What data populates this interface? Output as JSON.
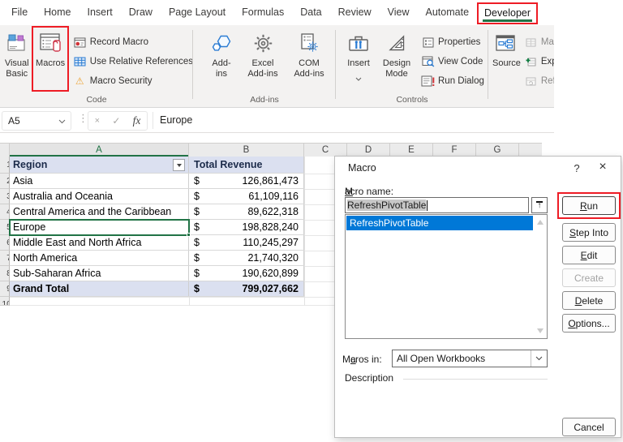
{
  "colors": {
    "excel_green": "#217346",
    "annotation_red": "#ee1c25",
    "selection_blue": "#0078d7",
    "table_header_fill": "#dbe0f0",
    "ribbon_bg": "#f3f2f1"
  },
  "icons": {
    "more_dots": "⋮",
    "cancel_x": "×",
    "check": "✓",
    "warning": "⚠",
    "up_arrow": "↑"
  },
  "ribbon": {
    "tabs": [
      "File",
      "Home",
      "Insert",
      "Draw",
      "Page Layout",
      "Formulas",
      "Data",
      "Review",
      "View",
      "Automate",
      "Developer"
    ],
    "active_tab": "Developer",
    "code_group": {
      "label": "Code",
      "visual_basic": {
        "line1": "Visual",
        "line2": "Basic"
      },
      "macros": "Macros",
      "record_macro": "Record Macro",
      "use_relative_references": "Use Relative References",
      "macro_security": "Macro Security"
    },
    "addins_group": {
      "label": "Add-ins",
      "addins": {
        "line1": "Add-",
        "line2": "ins"
      },
      "excel_addins": {
        "line1": "Excel",
        "line2": "Add-ins"
      },
      "com_addins": {
        "line1": "COM",
        "line2": "Add-ins"
      }
    },
    "controls_group": {
      "label": "Controls",
      "insert": "Insert",
      "design_mode": {
        "line1": "Design",
        "line2": "Mode"
      },
      "properties": "Properties",
      "view_code": "View Code",
      "run_dialog": "Run Dialog"
    },
    "xml_group": {
      "source": "Source",
      "map_properties": "Map Properties",
      "expansion_packs": "Expansion Packs",
      "refresh_data": "Refresh Data"
    }
  },
  "formula_bar": {
    "name_box": "A5",
    "fx": "fx",
    "formula": "Europe"
  },
  "sheet": {
    "columns": [
      "A",
      "B",
      "C",
      "D",
      "E",
      "F",
      "G"
    ],
    "selected_column": "A",
    "selected_cell": "A5",
    "row_numbers": [
      "1",
      "2",
      "3",
      "4",
      "5",
      "6",
      "7",
      "8",
      "9",
      "10"
    ],
    "table": {
      "header": {
        "region": "Region",
        "total_revenue": "Total Revenue"
      },
      "currency": "$",
      "rows": [
        {
          "region": "Asia",
          "amount": "126,861,473"
        },
        {
          "region": "Australia and Oceania",
          "amount": "61,109,116"
        },
        {
          "region": "Central America and the Caribbean",
          "amount": "89,622,318"
        },
        {
          "region": "Europe",
          "amount": "198,828,240",
          "selected": true
        },
        {
          "region": "Middle East and North Africa",
          "amount": "110,245,297"
        },
        {
          "region": "North America",
          "amount": "21,740,320"
        },
        {
          "region": "Sub-Saharan Africa",
          "amount": "190,620,899"
        }
      ],
      "total": {
        "region": "Grand Total",
        "amount": "799,027,662"
      }
    }
  },
  "dialog": {
    "title": "Macro",
    "help": "?",
    "close": "×",
    "macro_name_label": {
      "key": "M",
      "rest": "acro name:"
    },
    "macro_name_value": "RefreshPivotTable",
    "list_items": [
      "RefreshPivotTable"
    ],
    "buttons": {
      "run": {
        "key": "R",
        "rest": "un"
      },
      "step_into": {
        "key": "S",
        "rest": "tep Into"
      },
      "edit": {
        "key": "E",
        "rest": "dit"
      },
      "create": "Create",
      "delete": {
        "key": "D",
        "rest": "elete"
      },
      "options": {
        "key": "O",
        "rest": "ptions..."
      },
      "cancel": "Cancel"
    },
    "macros_in_label": {
      "pre": "M",
      "key": "a",
      "rest": "cros in:"
    },
    "macros_in_value": "All Open Workbooks",
    "description_label": "Description"
  }
}
